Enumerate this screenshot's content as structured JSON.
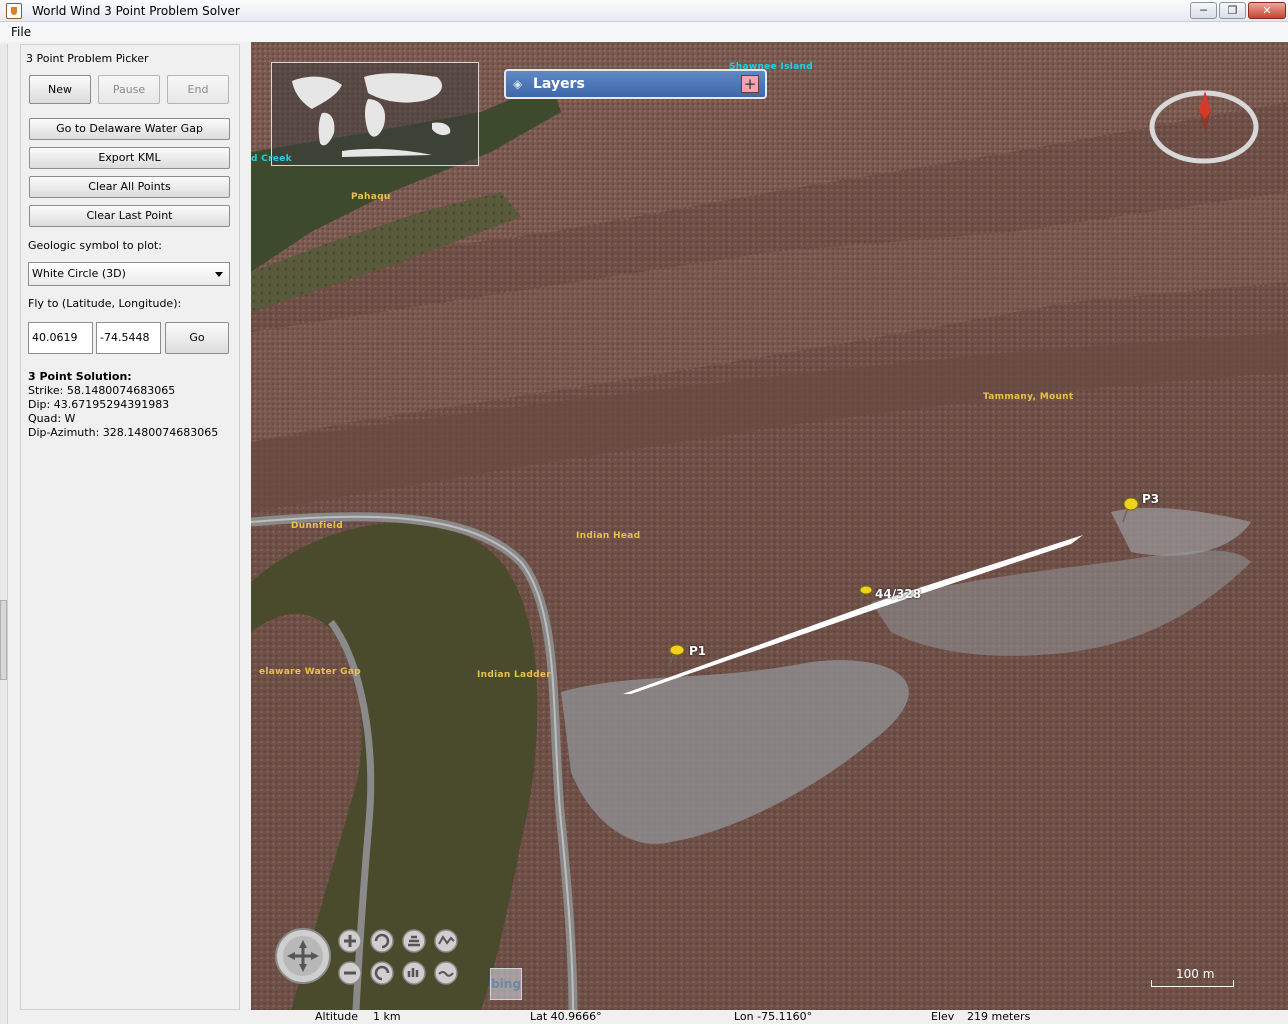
{
  "window": {
    "title": "World Wind 3 Point Problem Solver",
    "minimize_label": "─",
    "maximize_label": "❐",
    "close_label": "✕"
  },
  "menu": {
    "file_label": "File"
  },
  "picker": {
    "section_title": "3 Point Problem Picker",
    "new_label": "New",
    "pause_label": "Pause",
    "end_label": "End",
    "go_to_label": "Go to Delaware Water Gap",
    "export_label": "Export KML",
    "clear_all_label": "Clear All Points",
    "clear_last_label": "Clear Last Point",
    "symbol_label": "Geologic symbol to plot:",
    "symbol_value": "White Circle (3D)",
    "fly_label": "Fly to (Latitude, Longitude):",
    "latitude_value": "40.0619",
    "longitude_value": "-74.5448",
    "go_label": "Go"
  },
  "solution": {
    "heading": "3 Point Solution:",
    "strike": "Strike: 58.1480074683065",
    "dip": "Dip: 43.67195294391983",
    "quad": "Quad: W",
    "dip_azimuth": "Dip-Azimuth: 328.1480074683065"
  },
  "map": {
    "layers_label": "Layers",
    "layers_plus": "+",
    "places": {
      "shawnee": "Shawnee Island",
      "creek": "d Creek",
      "pahaqu": "Pahaqu",
      "tammany": "Tammany, Mount",
      "dunnfield": "Dunnfield",
      "indian_head": "Indian Head",
      "delaware_gap": "elaware Water Gap",
      "indian_ladder": "Indian Ladder"
    },
    "pins": {
      "p1": "P1",
      "p3": "P3",
      "solution": "44/328"
    },
    "scale_label": "100 m",
    "bing_label": "bing"
  },
  "status": {
    "altitude_label": "Altitude",
    "altitude_value": "1 km",
    "lat": "Lat 40.9666°",
    "lon": "Lon -75.1160°",
    "elev_label": "Elev",
    "elev_value": "219 meters"
  },
  "colors": {
    "accent": "#3e67a8",
    "place_label": "#e8c24a",
    "water_label": "#1fd0e0",
    "pin": "#f1d21b"
  }
}
